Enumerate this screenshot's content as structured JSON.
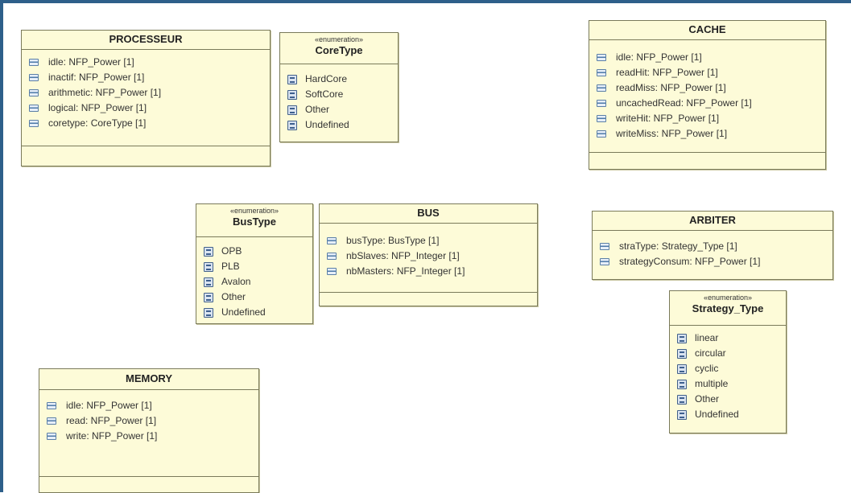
{
  "colors": {
    "class_fill": "#fdfbd8",
    "border": "#7a7a5a",
    "frame": "#2e5f8a"
  },
  "classes": {
    "processeur": {
      "name": "PROCESSEUR",
      "attributes": [
        "idle: NFP_Power [1]",
        "inactif: NFP_Power [1]",
        "arithmetic: NFP_Power [1]",
        "logical: NFP_Power [1]",
        "coretype: CoreType [1]"
      ]
    },
    "coretype": {
      "stereotype": "«enumeration»",
      "name": "CoreType",
      "literals": [
        "HardCore",
        "SoftCore",
        "Other",
        "Undefined"
      ]
    },
    "cache": {
      "name": "CACHE",
      "attributes": [
        "idle: NFP_Power [1]",
        "readHit: NFP_Power [1]",
        "readMiss: NFP_Power [1]",
        "uncachedRead: NFP_Power [1]",
        "writeHit: NFP_Power [1]",
        "writeMiss: NFP_Power [1]"
      ]
    },
    "bustype": {
      "stereotype": "«enumeration»",
      "name": "BusType",
      "literals": [
        "OPB",
        "PLB",
        "Avalon",
        "Other",
        "Undefined"
      ]
    },
    "bus": {
      "name": "BUS",
      "attributes": [
        "busType: BusType [1]",
        "nbSlaves: NFP_Integer [1]",
        "nbMasters: NFP_Integer [1]"
      ]
    },
    "arbiter": {
      "name": "ARBITER",
      "attributes": [
        "straType: Strategy_Type [1]",
        "strategyConsum: NFP_Power [1]"
      ]
    },
    "strategy_type": {
      "stereotype": "«enumeration»",
      "name": "Strategy_Type",
      "literals": [
        "linear",
        "circular",
        "cyclic",
        "multiple",
        "Other",
        "Undefined"
      ]
    },
    "memory": {
      "name": "MEMORY",
      "attributes": [
        "idle: NFP_Power [1]",
        "read: NFP_Power [1]",
        "write: NFP_Power [1]"
      ]
    }
  }
}
